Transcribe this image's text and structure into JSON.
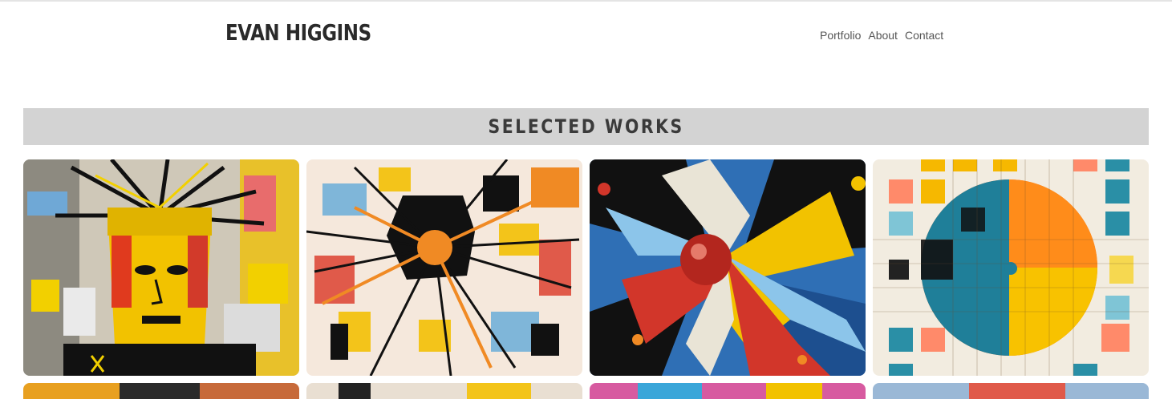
{
  "header": {
    "logo": "EVAN HIGGINS",
    "nav": [
      "Portfolio",
      "About",
      "Contact"
    ]
  },
  "section": {
    "title": "Selected Works"
  },
  "gallery": {
    "items": [
      {
        "name": "artwork-portrait-crown",
        "palette": [
          "#f2c200",
          "#1a1a1a",
          "#d93b2b",
          "#7fb6d9"
        ]
      },
      {
        "name": "artwork-burst-black",
        "palette": [
          "#f5e8dc",
          "#111111",
          "#f08a24",
          "#f3c41a"
        ]
      },
      {
        "name": "artwork-red-sphere",
        "palette": [
          "#2f6fb5",
          "#111111",
          "#f2c200",
          "#d2362a"
        ]
      },
      {
        "name": "artwork-grid-circle",
        "palette": [
          "#f2ece0",
          "#ff6a1a",
          "#2a8fa6",
          "#f6b800"
        ]
      }
    ]
  }
}
